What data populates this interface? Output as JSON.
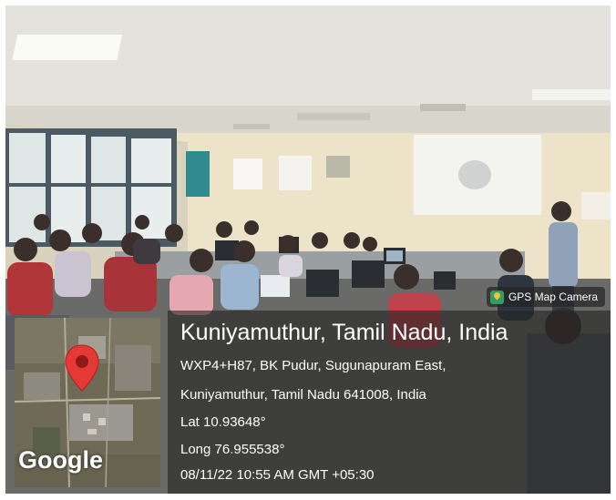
{
  "badge": {
    "label": "GPS Map Camera",
    "icon": "gps-map-camera-icon"
  },
  "map": {
    "logo_text": "Google",
    "pin_color": "#e53935"
  },
  "location": {
    "title": "Kuniyamuthur, Tamil Nadu, India",
    "address_line_1": "WXP4+H87, BK Pudur, Sugunapuram East,",
    "address_line_2": "Kuniyamuthur, Tamil Nadu 641008, India",
    "lat": "Lat 10.93648°",
    "long": "Long 76.955538°",
    "datetime": "08/11/22 10:55 AM GMT +05:30"
  }
}
